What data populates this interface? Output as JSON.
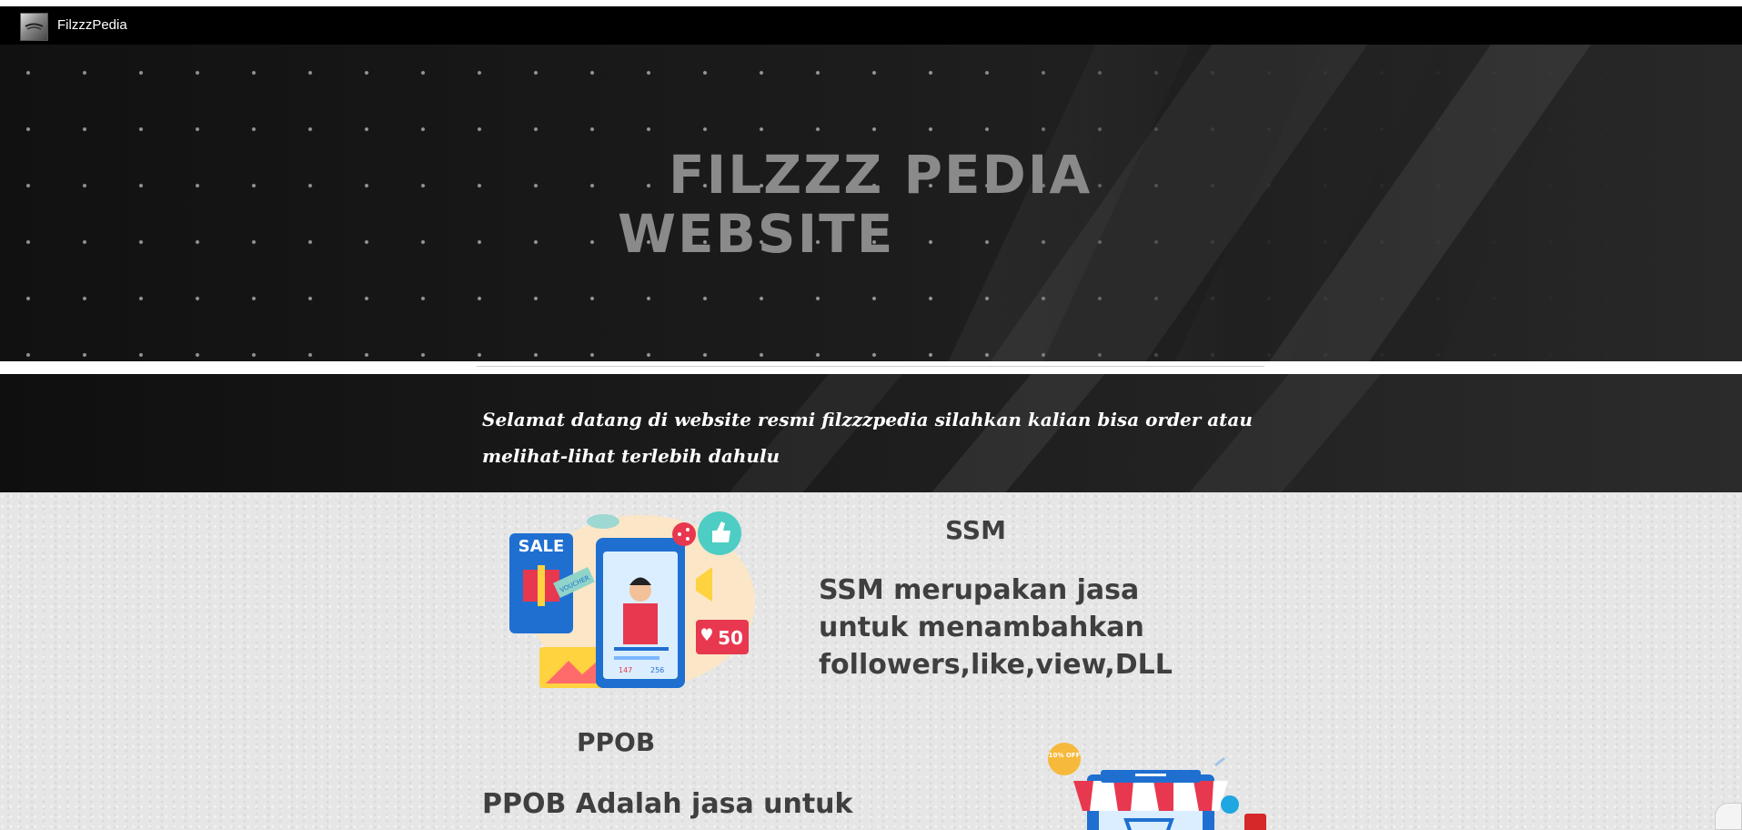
{
  "topbar": {
    "brand": "FilzzzPedia"
  },
  "hero": {
    "title_line1": "FILZZZ PEDIA",
    "title_line2": "WEBSITE"
  },
  "welcome": {
    "text": "Selamat datang di website resmi filzzzpedia silahkan kalian bisa order atau melihat-lihat terlebih dahulu"
  },
  "ssm": {
    "title": "SSM",
    "description": "SSM merupakan jasa untuk menambahkan followers,like,view,DLL",
    "illustration_labels": {
      "sale": "SALE",
      "voucher": "VOUCHER",
      "likes_badge": "50",
      "likes_count": "147",
      "comments_count": "256"
    }
  },
  "ppob": {
    "title": "PPOB",
    "description": "PPOB Adalah jasa untuk",
    "illustration_labels": {
      "discount": "10% OFF"
    }
  },
  "colors": {
    "topbar_bg": "#000000",
    "hero_text": "#8a8a8a",
    "content_bg": "#e6e6e6",
    "content_text": "#3f3f3f"
  }
}
